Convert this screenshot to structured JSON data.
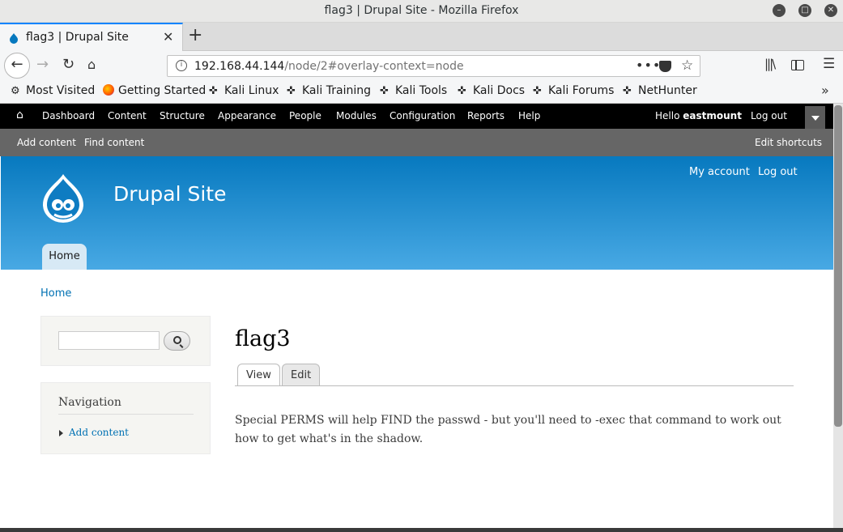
{
  "window": {
    "title": "flag3 | Drupal Site - Mozilla Firefox"
  },
  "browser": {
    "tab_title": "flag3 | Drupal Site",
    "url_host": "192.168.44.144",
    "url_path": "/node/2#overlay-context=node",
    "bookmarks": [
      "Most Visited",
      "Getting Started",
      "Kali Linux",
      "Kali Training",
      "Kali Tools",
      "Kali Docs",
      "Kali Forums",
      "NetHunter"
    ]
  },
  "admin_toolbar": {
    "items": [
      "Dashboard",
      "Content",
      "Structure",
      "Appearance",
      "People",
      "Modules",
      "Configuration",
      "Reports",
      "Help"
    ],
    "hello": "Hello",
    "username": "eastmount",
    "logout": "Log out",
    "shortcuts": [
      "Add content",
      "Find content"
    ],
    "edit_shortcuts": "Edit shortcuts"
  },
  "header": {
    "site_name": "Drupal Site",
    "my_account": "My account",
    "log_out": "Log out",
    "home_tab": "Home"
  },
  "content": {
    "breadcrumb": "Home",
    "navigation_title": "Navigation",
    "navigation_item": "Add content",
    "page_title": "flag3",
    "tabs": [
      "View",
      "Edit"
    ],
    "body": "Special PERMS will help FIND the passwd - but you'll need to -exec that command to work out how to get what's in the shadow."
  },
  "colors": {
    "accent": "#0779bf",
    "link": "#0071b3",
    "toolbar": "#000000"
  }
}
